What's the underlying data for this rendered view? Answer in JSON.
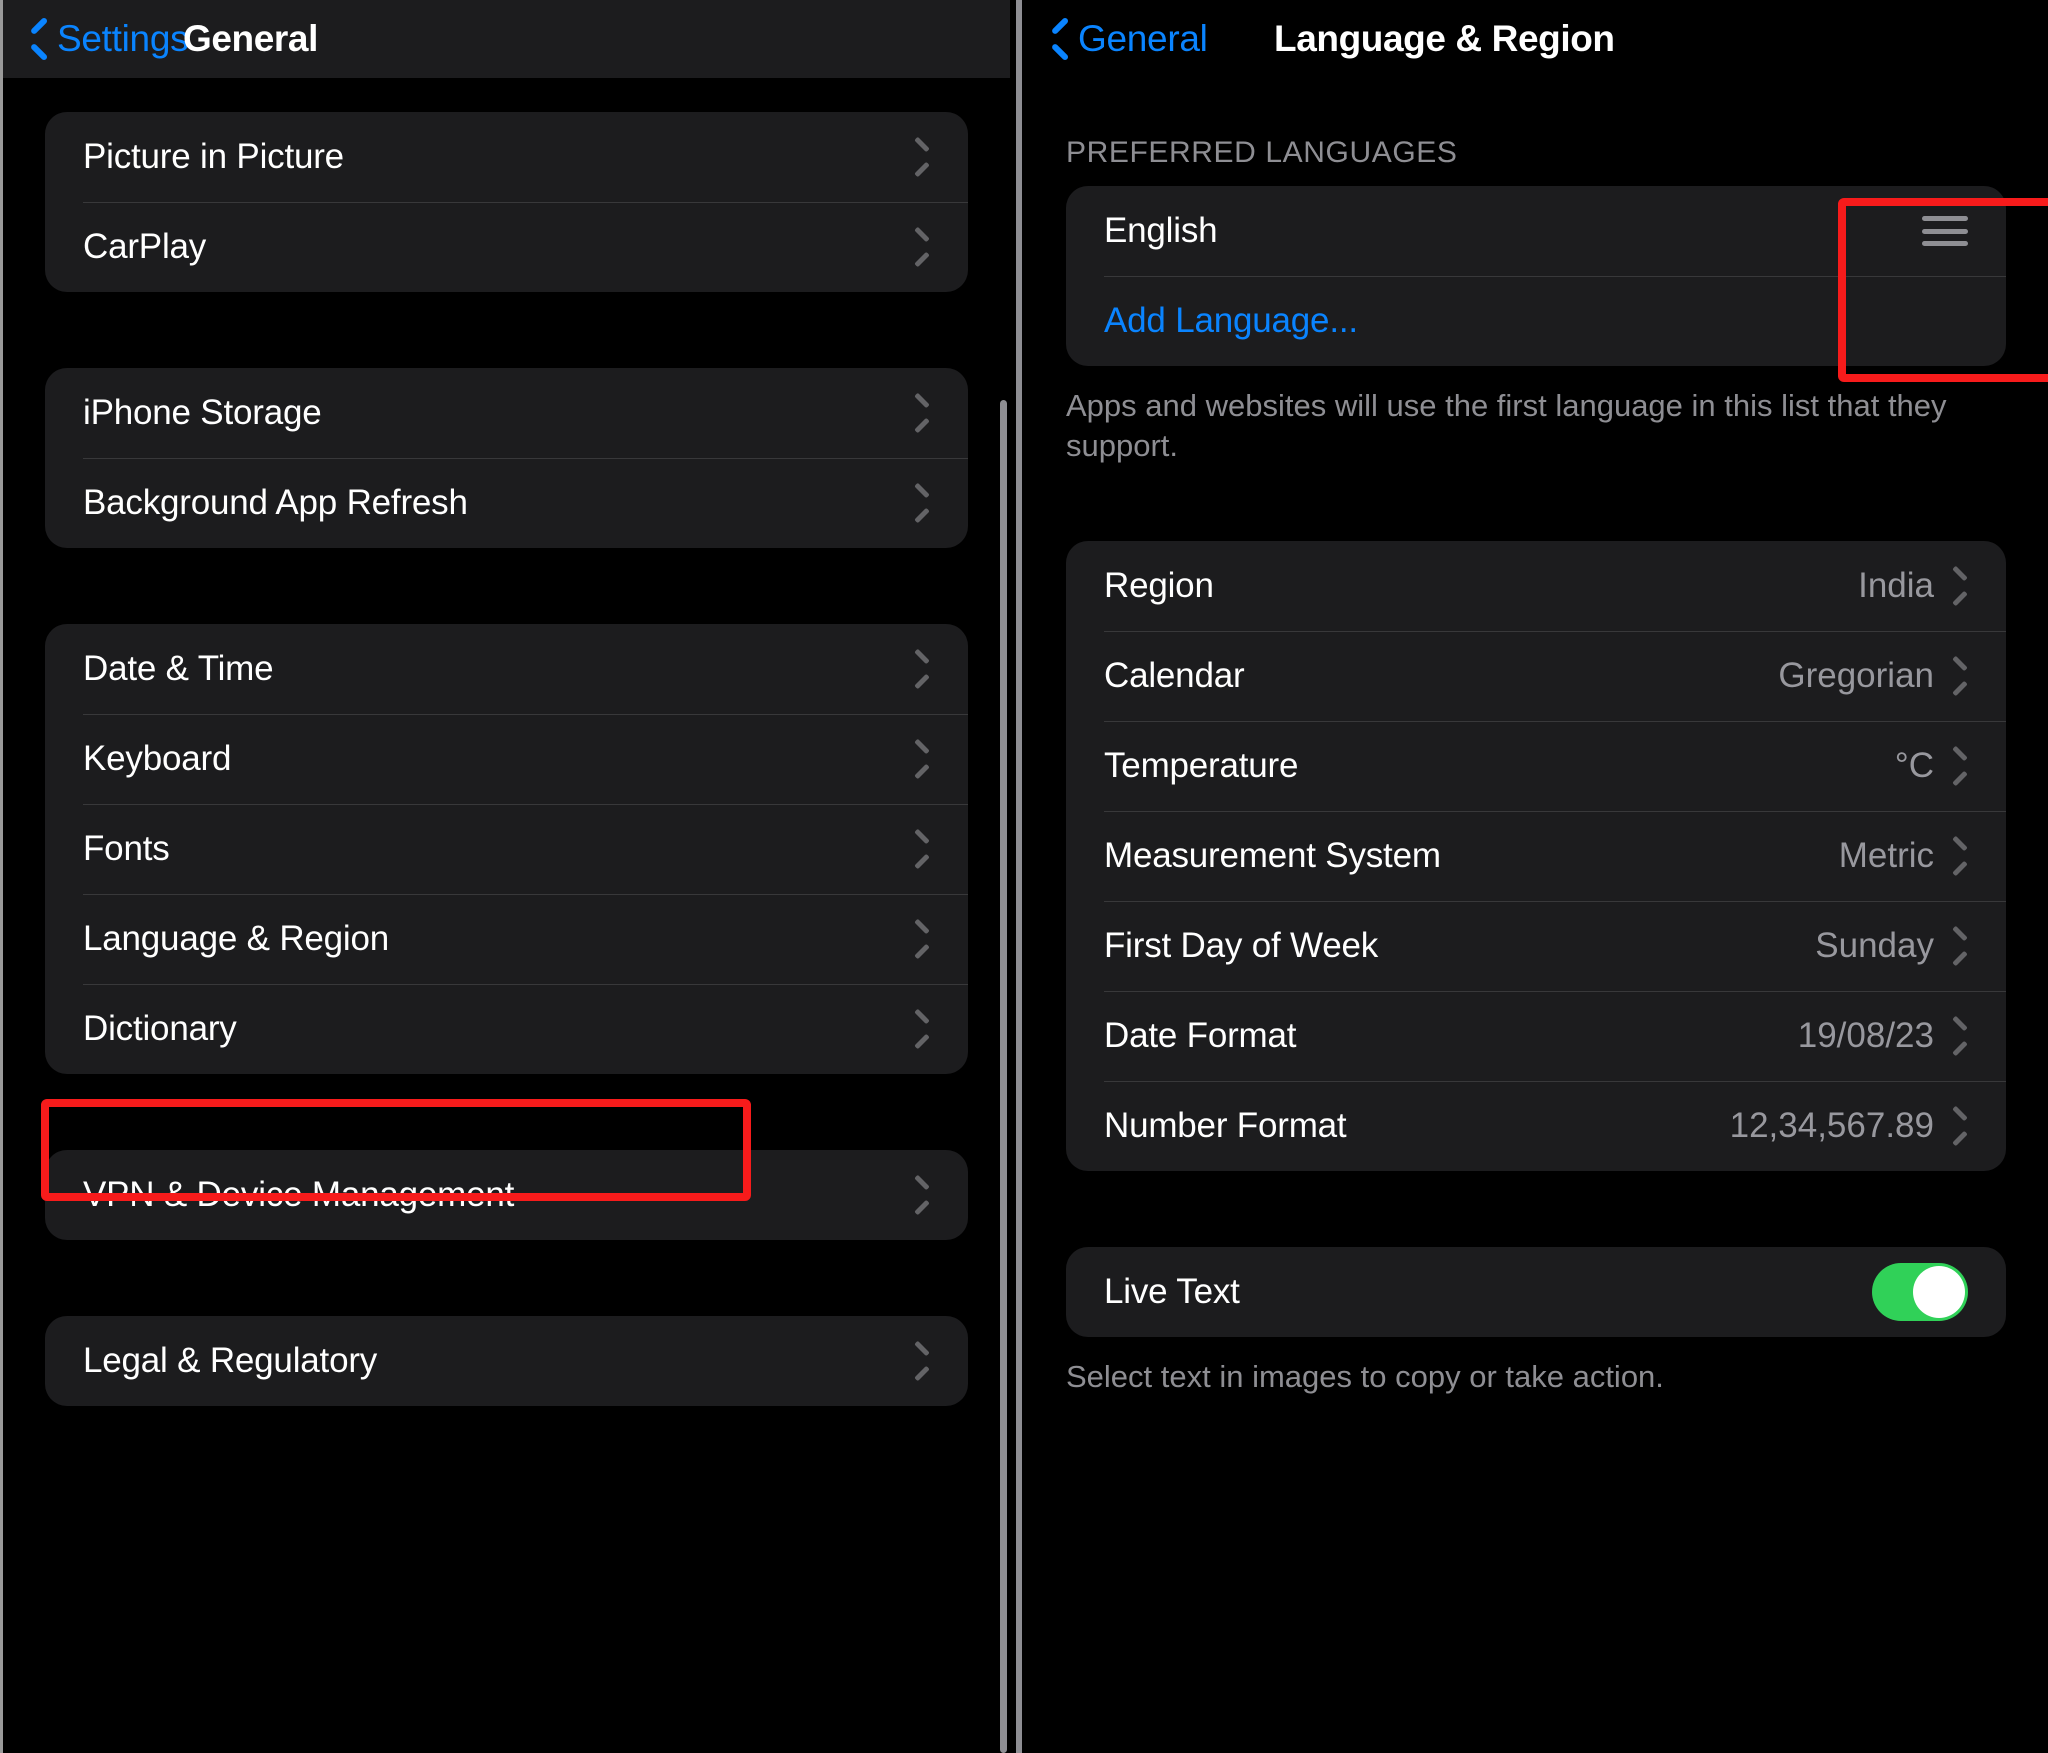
{
  "left_panel": {
    "nav": {
      "back_label": "Settings",
      "title": "General",
      "back_icon": "chevron-left-icon"
    },
    "groups": [
      {
        "rows": [
          {
            "label": "Picture in Picture",
            "accessory": "chevron-right-icon"
          },
          {
            "label": "CarPlay",
            "accessory": "chevron-right-icon"
          }
        ]
      },
      {
        "rows": [
          {
            "label": "iPhone Storage",
            "accessory": "chevron-right-icon"
          },
          {
            "label": "Background App Refresh",
            "accessory": "chevron-right-icon"
          }
        ]
      },
      {
        "rows": [
          {
            "label": "Date & Time",
            "accessory": "chevron-right-icon"
          },
          {
            "label": "Keyboard",
            "accessory": "chevron-right-icon"
          },
          {
            "label": "Fonts",
            "accessory": "chevron-right-icon"
          },
          {
            "label": "Language & Region",
            "accessory": "chevron-right-icon"
          },
          {
            "label": "Dictionary",
            "accessory": "chevron-right-icon"
          }
        ]
      },
      {
        "rows": [
          {
            "label": "VPN & Device Management",
            "accessory": "chevron-right-icon"
          }
        ]
      },
      {
        "rows": [
          {
            "label": "Legal & Regulatory",
            "accessory": "chevron-right-icon"
          }
        ]
      }
    ],
    "highlight": {
      "target": "Language & Region",
      "color": "#f71b1b"
    }
  },
  "right_panel": {
    "nav": {
      "back_label": "General",
      "title": "Language & Region",
      "back_icon": "chevron-left-icon"
    },
    "preferred_languages": {
      "header": "PREFERRED LANGUAGES",
      "rows": [
        {
          "label": "English",
          "accessory": "reorder-handle-icon"
        },
        {
          "label": "Add Language...",
          "accessory": "none",
          "style": "blue"
        }
      ],
      "footer": "Apps and websites will use the first language in this list that they support."
    },
    "region_settings": {
      "rows": [
        {
          "label": "Region",
          "value": "India",
          "accessory": "chevron-right-icon"
        },
        {
          "label": "Calendar",
          "value": "Gregorian",
          "accessory": "chevron-right-icon"
        },
        {
          "label": "Temperature",
          "value": "°C",
          "accessory": "chevron-right-icon"
        },
        {
          "label": "Measurement System",
          "value": "Metric",
          "accessory": "chevron-right-icon"
        },
        {
          "label": "First Day of Week",
          "value": "Sunday",
          "accessory": "chevron-right-icon"
        },
        {
          "label": "Date Format",
          "value": "19/08/23",
          "accessory": "chevron-right-icon"
        },
        {
          "label": "Number Format",
          "value": "12,34,567.89",
          "accessory": "chevron-right-icon"
        }
      ]
    },
    "live_text": {
      "label": "Live Text",
      "enabled": true,
      "footer": "Select text in images to copy or take action."
    },
    "highlight": {
      "target": "preferred-languages-card",
      "color": "#f71b1b"
    }
  },
  "colors": {
    "accent_blue": "#0a84ff",
    "highlight_red": "#f71b1b",
    "toggle_green": "#30d158",
    "card_bg": "#1c1c1e",
    "page_bg": "#000000",
    "secondary_text": "#8e8e93"
  }
}
